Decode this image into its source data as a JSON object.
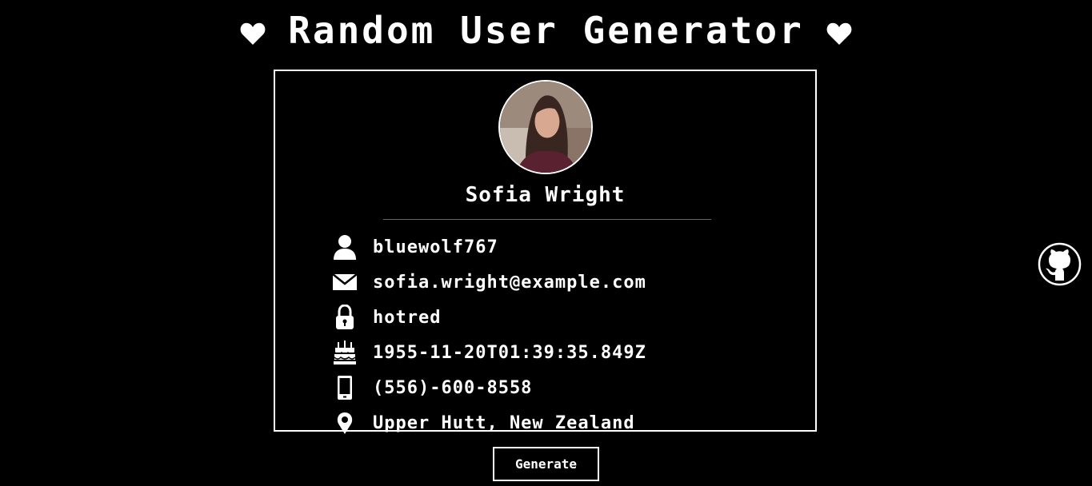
{
  "header": {
    "title": "Random User Generator",
    "left_icon": "heart-icon",
    "right_icon": "heart-icon"
  },
  "card": {
    "avatar_icon": "avatar",
    "name": "Sofia Wright",
    "details": [
      {
        "icon": "user-icon",
        "value": "bluewolf767"
      },
      {
        "icon": "envelope-icon",
        "value": "sofia.wright@example.com"
      },
      {
        "icon": "lock-icon",
        "value": "hotred"
      },
      {
        "icon": "birthday-cake-icon",
        "value": "1955-11-20T01:39:35.849Z"
      },
      {
        "icon": "phone-icon",
        "value": "(556)-600-8558"
      },
      {
        "icon": "location-pin-icon",
        "value": "Upper Hutt, New Zealand"
      }
    ]
  },
  "actions": {
    "generate_label": "Generate"
  },
  "links": {
    "github_icon": "github-icon"
  },
  "colors": {
    "background": "#000000",
    "foreground": "#ffffff",
    "divider": "#666666"
  }
}
